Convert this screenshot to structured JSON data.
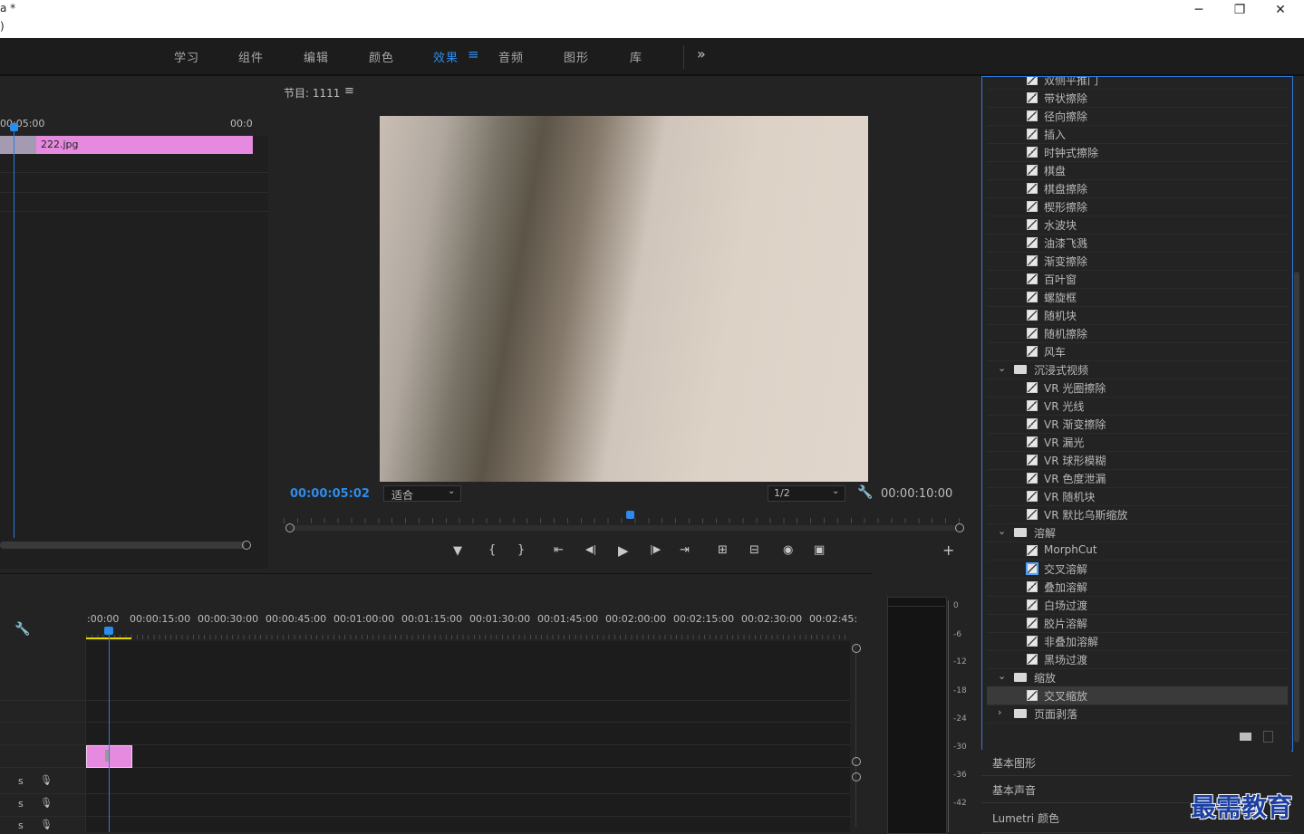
{
  "titlebar": {
    "line1": "a *",
    "line2": ")",
    "min": "─",
    "max": "❐",
    "close": "✕"
  },
  "menu": {
    "items": [
      "学习",
      "组件",
      "编辑",
      "颜色",
      "效果",
      "音频",
      "图形",
      "库"
    ],
    "active_index": 4,
    "overflow": "»",
    "active_menu_glyph": "≡"
  },
  "source_panel": {
    "time_left": "00:05:00",
    "time_right": "00:0",
    "clip_name": "222.jpg"
  },
  "program": {
    "title": "节目: 1111",
    "menu_glyph": "≡",
    "current_time": "00:00:05:02",
    "fit_select": "适合",
    "quality_select": "1/2",
    "duration": "00:00:10:00",
    "controls": [
      "▼",
      "{",
      "}",
      "⇤",
      "◀|",
      "▶",
      "|▶",
      "⇥",
      "⊞",
      "⊟",
      "◉",
      "▣"
    ],
    "add": "+"
  },
  "timeline": {
    "ruler": [
      ":00:00",
      "00:00:15:00",
      "00:00:30:00",
      "00:00:45:00",
      "00:01:00:00",
      "00:01:15:00",
      "00:01:30:00",
      "00:01:45:00",
      "00:02:00:00",
      "00:02:15:00",
      "00:02:30:00",
      "00:02:45:"
    ],
    "track_labels": [
      "s",
      "s",
      "s"
    ]
  },
  "audio_meter": {
    "labels": [
      "0",
      "-6",
      "-12",
      "-18",
      "-24",
      "-30",
      "-36",
      "-42"
    ]
  },
  "effects": {
    "items": [
      {
        "kind": "effect",
        "label": "双侧平推门"
      },
      {
        "kind": "effect",
        "label": "带状擦除"
      },
      {
        "kind": "effect",
        "label": "径向擦除"
      },
      {
        "kind": "effect",
        "label": "插入"
      },
      {
        "kind": "effect",
        "label": "时钟式擦除"
      },
      {
        "kind": "effect",
        "label": "棋盘"
      },
      {
        "kind": "effect",
        "label": "棋盘擦除"
      },
      {
        "kind": "effect",
        "label": "楔形擦除"
      },
      {
        "kind": "effect",
        "label": "水波块"
      },
      {
        "kind": "effect",
        "label": "油漆飞溅"
      },
      {
        "kind": "effect",
        "label": "渐变擦除"
      },
      {
        "kind": "effect",
        "label": "百叶窗"
      },
      {
        "kind": "effect",
        "label": "螺旋框"
      },
      {
        "kind": "effect",
        "label": "随机块"
      },
      {
        "kind": "effect",
        "label": "随机擦除"
      },
      {
        "kind": "effect",
        "label": "风车"
      },
      {
        "kind": "folder",
        "label": "沉浸式视频",
        "open": true
      },
      {
        "kind": "effect",
        "label": "VR 光圈擦除"
      },
      {
        "kind": "effect",
        "label": "VR 光线"
      },
      {
        "kind": "effect",
        "label": "VR 渐变擦除"
      },
      {
        "kind": "effect",
        "label": "VR 漏光"
      },
      {
        "kind": "effect",
        "label": "VR 球形模糊"
      },
      {
        "kind": "effect",
        "label": "VR 色度泄漏"
      },
      {
        "kind": "effect",
        "label": "VR 随机块"
      },
      {
        "kind": "effect",
        "label": "VR 默比乌斯缩放"
      },
      {
        "kind": "folder",
        "label": "溶解",
        "open": true
      },
      {
        "kind": "effect",
        "label": "MorphCut"
      },
      {
        "kind": "effect",
        "label": "交叉溶解",
        "highlight": true
      },
      {
        "kind": "effect",
        "label": "叠加溶解"
      },
      {
        "kind": "effect",
        "label": "白场过渡"
      },
      {
        "kind": "effect",
        "label": "胶片溶解"
      },
      {
        "kind": "effect",
        "label": "非叠加溶解"
      },
      {
        "kind": "effect",
        "label": "黑场过渡"
      },
      {
        "kind": "folder",
        "label": "缩放",
        "open": true
      },
      {
        "kind": "effect",
        "label": "交叉缩放",
        "selected": true
      },
      {
        "kind": "folder",
        "label": "页面剥落",
        "open": false
      }
    ],
    "chev_open": "⌄",
    "chev_closed": "›"
  },
  "sections": [
    "基本图形",
    "基本声音",
    "Lumetri 颜色"
  ],
  "watermark": "最需教育",
  "colors": {
    "accent": "#2d8ceb",
    "clip": "#e68ae0",
    "playhead": "#2d7be0"
  }
}
